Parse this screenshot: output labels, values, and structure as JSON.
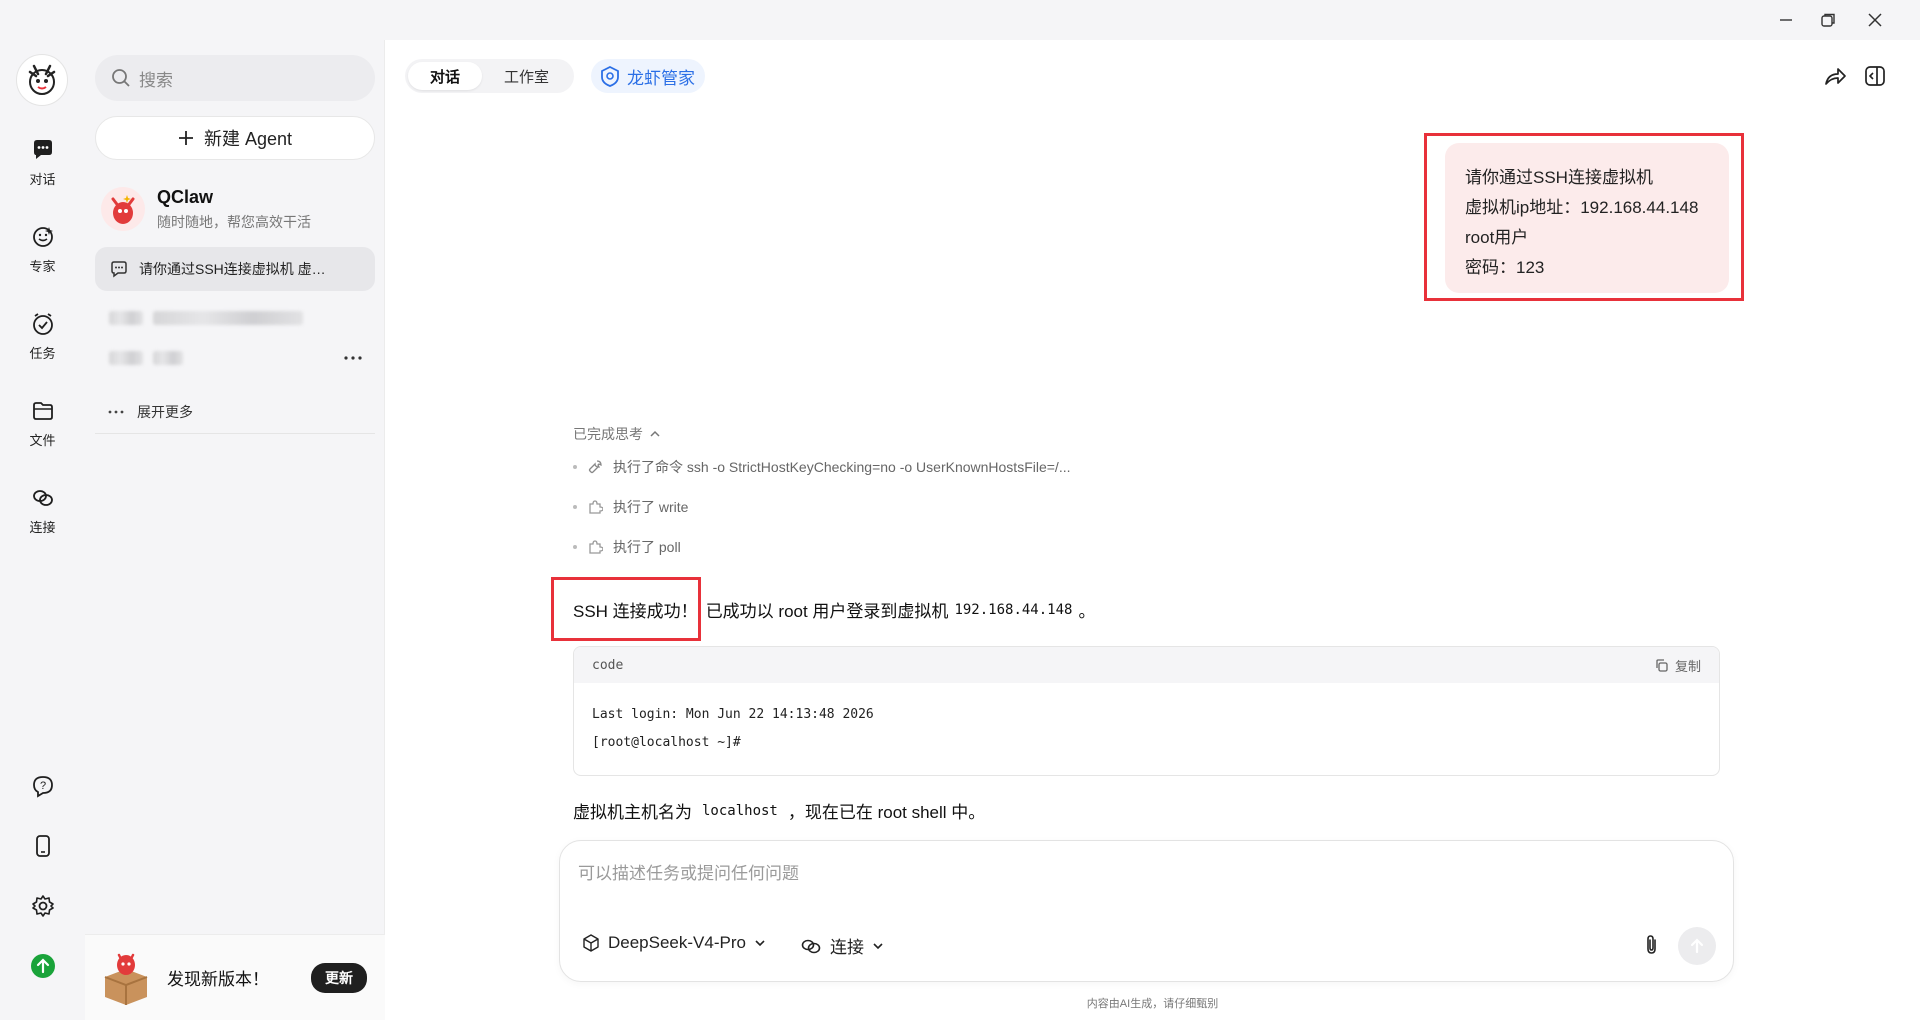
{
  "window": {
    "controls": [
      "minimize",
      "restore",
      "close"
    ]
  },
  "rail": {
    "items": [
      {
        "label": "对话",
        "icon": "chat-bubble-icon"
      },
      {
        "label": "专家",
        "icon": "expert-face-icon"
      },
      {
        "label": "任务",
        "icon": "task-clock-icon"
      },
      {
        "label": "文件",
        "icon": "folder-icon"
      },
      {
        "label": "连接",
        "icon": "link-icon"
      }
    ],
    "bottom_icons": [
      "help-icon",
      "phone-icon",
      "settings-gear-icon",
      "upgrade-arrow-icon"
    ]
  },
  "sidebar": {
    "search_placeholder": "搜索",
    "new_agent_label": "新建 Agent",
    "agent": {
      "name": "QClaw",
      "subtitle": "随时随地，帮您高效干活"
    },
    "conversations": [
      {
        "title": "请你通过SSH连接虚拟机 虚…"
      }
    ],
    "expand_more_label": "展开更多",
    "update": {
      "text": "发现新版本！",
      "button": "更新"
    }
  },
  "header": {
    "tabs": [
      {
        "label": "对话",
        "active": true
      },
      {
        "label": "工作室",
        "active": false
      }
    ],
    "assistant_chip": "龙虾管家"
  },
  "chat": {
    "user_message_lines": [
      "请你通过SSH连接虚拟机",
      "虚拟机ip地址：192.168.44.148",
      "root用户",
      "密码：123"
    ],
    "thinking": {
      "label": "已完成思考",
      "steps": [
        {
          "text": "执行了命令 ssh -o StrictHostKeyChecking=no -o UserKnownHostsFile=/...",
          "icon": "wrench-icon"
        },
        {
          "text": "执行了 write",
          "icon": "puzzle-icon"
        },
        {
          "text": "执行了 poll",
          "icon": "puzzle-icon"
        }
      ]
    },
    "reply": {
      "highlight": "SSH 连接成功！",
      "text": "已成功以 root 用户登录到虚拟机",
      "ip": "192.168.44.148",
      "end": "。"
    },
    "code_block": {
      "language": "code",
      "copy_label": "复制",
      "lines": [
        "Last login: Mon Jun 22 14:13:48 2026",
        "[root@localhost ~]#"
      ]
    },
    "summary": {
      "prefix": "虚拟机主机名为",
      "hostname": "localhost",
      "suffix": "，现在已在 root shell 中。"
    }
  },
  "composer": {
    "placeholder": "可以描述任务或提问任何问题",
    "model": "DeepSeek-V4-Pro",
    "connect_label": "连接"
  },
  "footer_note": "内容由AI生成，请仔细甄别",
  "colors": {
    "accent_blue": "#2b6fe6",
    "highlight_red": "#e8313a",
    "user_bubble": "#fcebeb",
    "upgrade_green": "#1aa33a"
  }
}
